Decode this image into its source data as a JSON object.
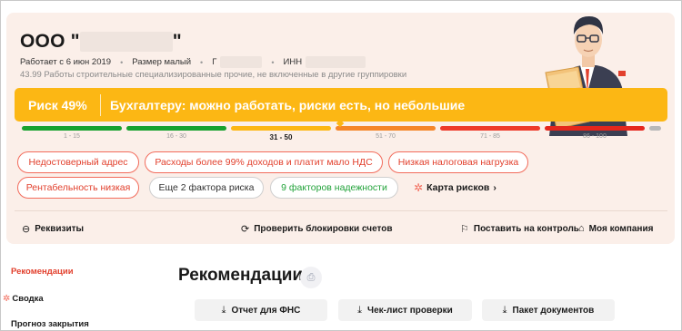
{
  "company": {
    "name_prefix": "ООО \"",
    "name_suffix": "\"",
    "works_since": "Работает с 6 июн 2019",
    "size": "Размер малый",
    "city_label": "Г",
    "inn_label": "ИНН",
    "okved": "43.99 Работы строительные специализированные прочие, не включенные в другие группировки"
  },
  "risk": {
    "value_label": "Риск 49%",
    "message": "Бухгалтеру: можно работать, риски есть, но небольшие",
    "level_percent": 49
  },
  "scale": {
    "segments": [
      {
        "label": "1 - 15",
        "color": "#18a22f",
        "active": false
      },
      {
        "label": "16 - 30",
        "color": "#18a22f",
        "active": false
      },
      {
        "label": "31 - 50",
        "color": "#fcb714",
        "active": true
      },
      {
        "label": "51 - 70",
        "color": "#f5862a",
        "active": false
      },
      {
        "label": "71 - 85",
        "color": "#ee3a2a",
        "active": false
      },
      {
        "label": "86 - 100",
        "color": "#e5261c",
        "active": false
      }
    ]
  },
  "factors": {
    "chip1": "Недостоверный адрес",
    "chip2": "Расходы более 99% доходов и платит мало НДС",
    "chip3": "Низкая налоговая нагрузка",
    "chip4": "Рентабельность низкая",
    "more": "Еще 2 фактора риска",
    "reliability": "9 факторов надежности",
    "risk_map": "Карта рисков"
  },
  "actions": {
    "requisites": "Реквизиты",
    "check_blocks": "Проверить блокировки счетов",
    "monitor": "Поставить на контроль",
    "my_company": "Моя компания"
  },
  "sidebar": {
    "recommendations": "Рекомендации",
    "summary": "Сводка",
    "forecast": "Прогноз закрытия"
  },
  "recommendations": {
    "title": "Рекомендации",
    "report_fns": "Отчет для ФНС",
    "checklist": "Чек-лист проверки",
    "documents": "Пакет документов"
  },
  "colors": {
    "accent": "#fcb714",
    "danger": "#e2402d",
    "success": "#23a33b",
    "card_bg": "#fbefe9"
  }
}
